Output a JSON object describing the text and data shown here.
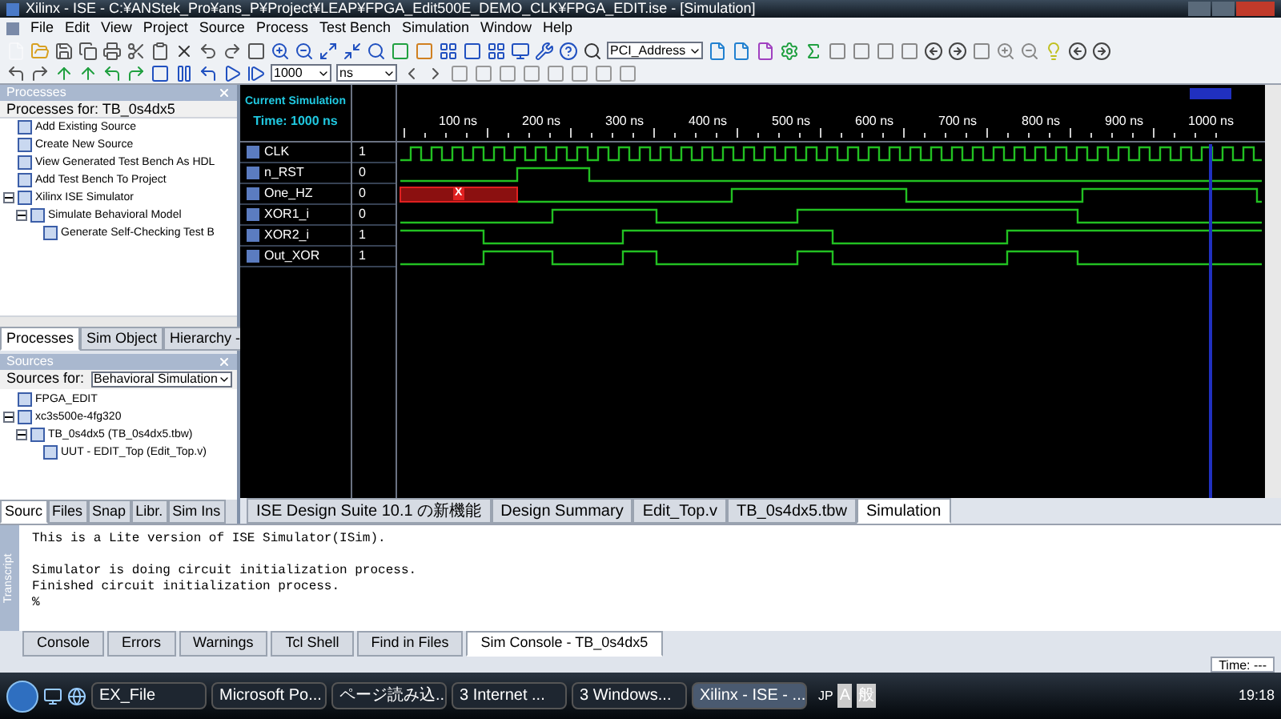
{
  "window": {
    "title": "Xilinx - ISE - C:¥ANStek_Pro¥ans_P¥Project¥LEAP¥FPGA_Edit500E_DEMO_CLK¥FPGA_EDIT.ise - [Simulation]"
  },
  "menu": [
    "File",
    "Edit",
    "View",
    "Project",
    "Source",
    "Process",
    "Test Bench",
    "Simulation",
    "Window",
    "Help"
  ],
  "toolbar": {
    "search_value": "PCI_Address",
    "time_value": "1000",
    "time_unit": "ns"
  },
  "processes_panel": {
    "title": "Processes",
    "header": "Processes for: TB_0s4dx5",
    "items": [
      {
        "label": "Add Existing Source"
      },
      {
        "label": "Create New Source"
      },
      {
        "label": "View Generated Test Bench As HDL"
      },
      {
        "label": "Add Test Bench To Project"
      },
      {
        "label": "Xilinx ISE Simulator",
        "expanded": true,
        "children": [
          {
            "label": "Simulate Behavioral Model",
            "expanded": true,
            "children": [
              {
                "label": "Generate Self-Checking Test B"
              }
            ]
          }
        ]
      }
    ],
    "tabs": [
      {
        "label": "Processes",
        "selected": true
      },
      {
        "label": "Sim Object",
        "selected": false
      },
      {
        "label": "Hierarchy -",
        "selected": false
      }
    ]
  },
  "sources_panel": {
    "title": "Sources",
    "sources_for_label": "Sources for:",
    "sources_for_value": "Behavioral Simulation",
    "items": [
      {
        "label": "FPGA_EDIT"
      },
      {
        "label": "xc3s500e-4fg320",
        "expanded": true,
        "children": [
          {
            "label": "TB_0s4dx5 (TB_0s4dx5.tbw)",
            "expanded": true,
            "children": [
              {
                "label": "UUT - EDIT_Top (Edit_Top.v)"
              }
            ]
          }
        ]
      }
    ],
    "tabs": [
      {
        "label": "Sourc",
        "selected": true
      },
      {
        "label": "Files",
        "selected": false
      },
      {
        "label": "Snap",
        "selected": false
      },
      {
        "label": "Libr.",
        "selected": false
      },
      {
        "label": "Sim Ins",
        "selected": false
      }
    ]
  },
  "waveform": {
    "current_label": "Current Simulation",
    "current_time": "Time: 1000 ns",
    "ruler": [
      "100 ns",
      "200 ns",
      "300 ns",
      "400 ns",
      "500 ns",
      "600 ns",
      "700 ns",
      "800 ns",
      "900 ns",
      "1000 ns"
    ],
    "signals": [
      {
        "name": "CLK",
        "value": "1"
      },
      {
        "name": "n_RST",
        "value": "0"
      },
      {
        "name": "One_HZ",
        "value": "0",
        "unknown_mark": "X"
      },
      {
        "name": "XOR1_i",
        "value": "0"
      },
      {
        "name": "XOR2_i",
        "value": "1"
      },
      {
        "name": "Out_XOR",
        "value": "1"
      }
    ]
  },
  "document_tabs": [
    {
      "label": "ISE Design Suite 10.1 の新機能",
      "selected": false
    },
    {
      "label": "Design Summary",
      "selected": false
    },
    {
      "label": "Edit_Top.v",
      "selected": false
    },
    {
      "label": "TB_0s4dx5.tbw",
      "selected": false
    },
    {
      "label": "Simulation",
      "selected": true
    }
  ],
  "console": {
    "side_label": "Transcript",
    "paragraphs": [
      [
        "This is a Lite version of ISE Simulator(ISim)."
      ],
      [
        "Simulator is doing circuit initialization process.",
        "Finished circuit initialization process.",
        "%"
      ]
    ]
  },
  "console_tabs": [
    {
      "label": "Console",
      "selected": false
    },
    {
      "label": "Errors",
      "selected": false
    },
    {
      "label": "Warnings",
      "selected": false
    },
    {
      "label": "Tcl Shell",
      "selected": false
    },
    {
      "label": "Find in Files",
      "selected": false
    },
    {
      "label": "Sim Console - TB_0s4dx5",
      "selected": true
    }
  ],
  "status_bar": {
    "time": "Time: ---"
  },
  "taskbar": {
    "tasks": [
      {
        "label": "EX_File",
        "selected": false
      },
      {
        "label": "Microsoft Po...",
        "selected": false
      },
      {
        "label": "ページ読み込...",
        "selected": false
      },
      {
        "label": "3 Internet ...",
        "selected": false
      },
      {
        "label": "3 Windows...",
        "selected": false
      },
      {
        "label": "Xilinx - ISE - ...",
        "selected": true
      }
    ],
    "language": "JP",
    "ime": [
      "A",
      "般"
    ],
    "clock": "19:18"
  }
}
